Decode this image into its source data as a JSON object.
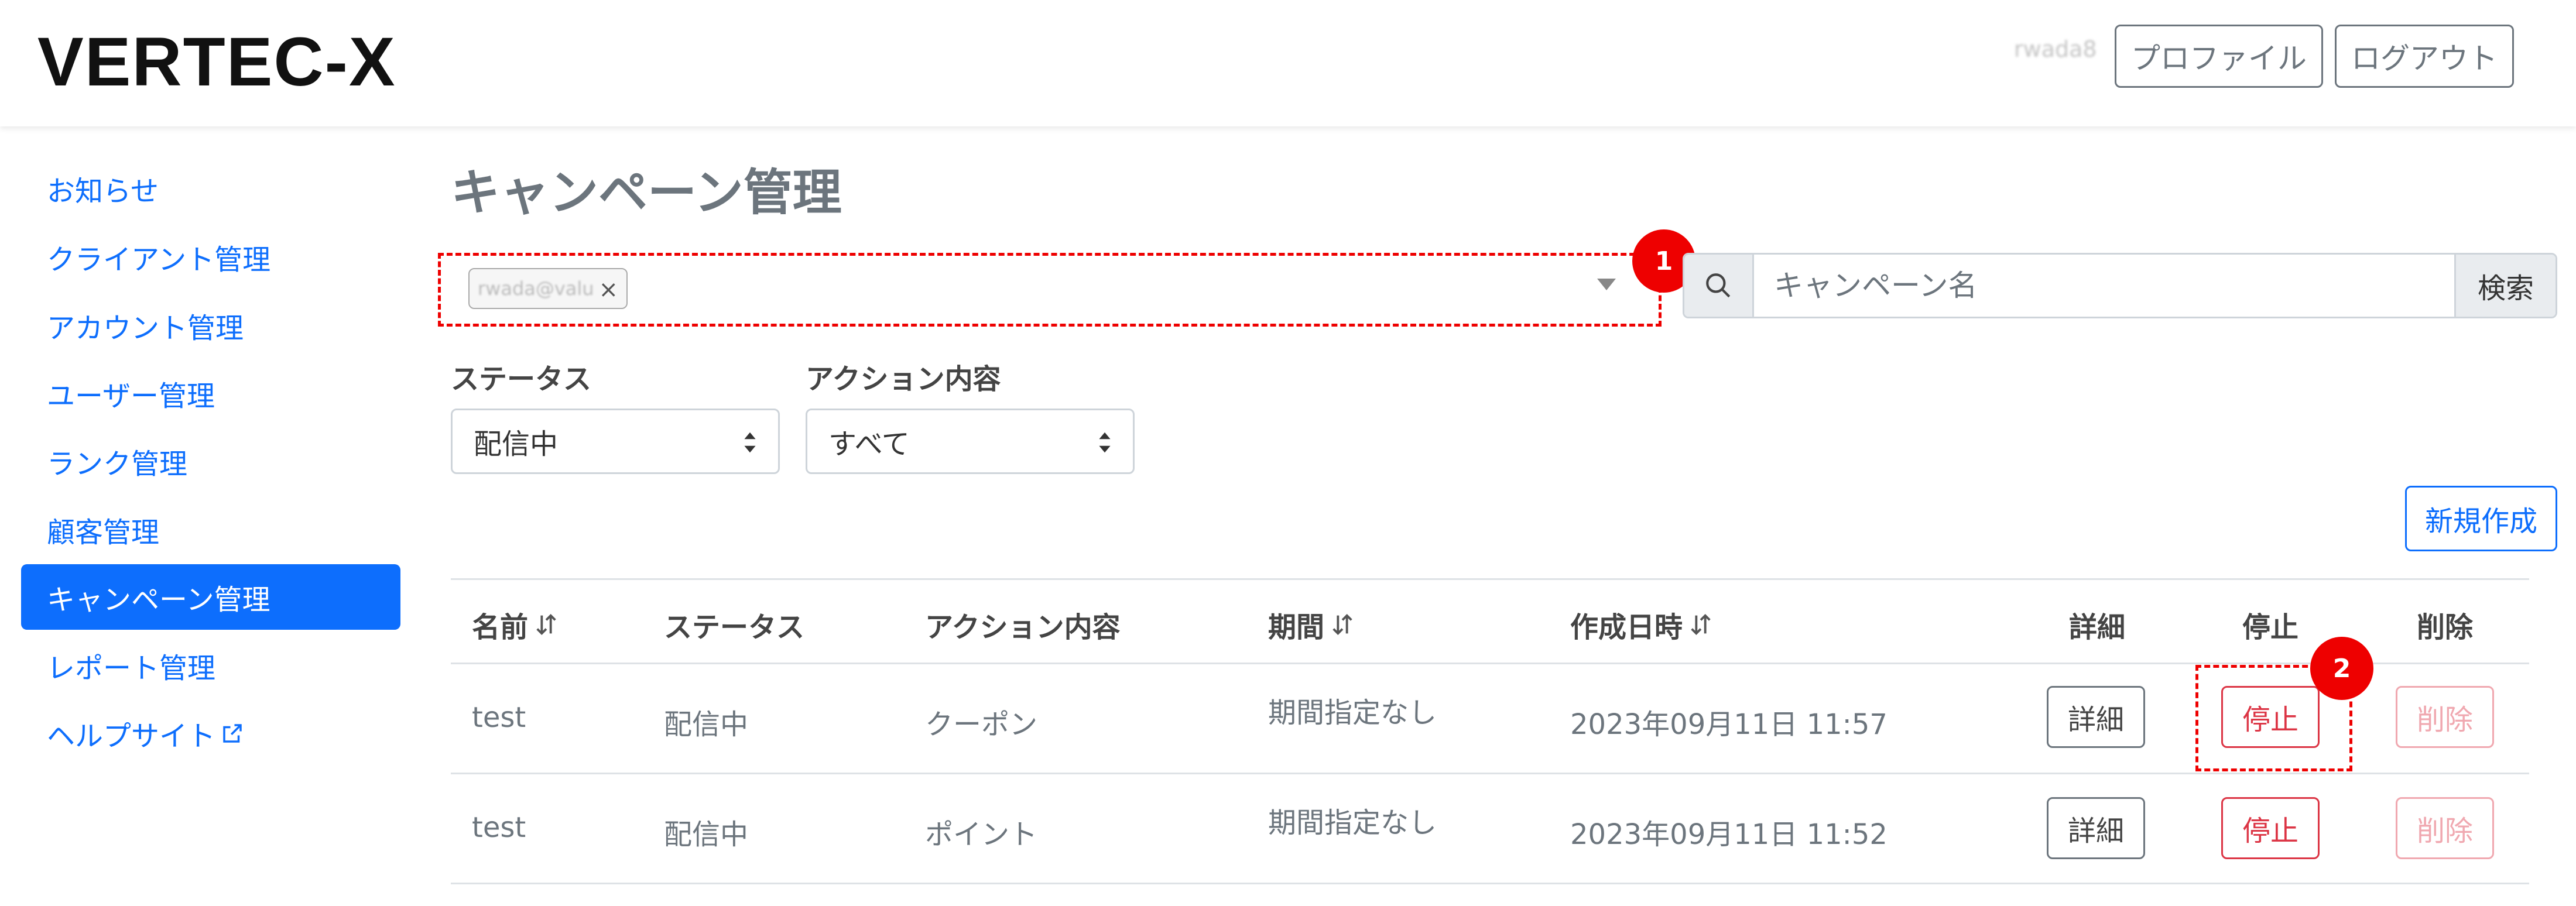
{
  "header": {
    "logo": "VERTEC-X",
    "username": "rwada8",
    "profile_label": "プロファイル",
    "logout_label": "ログアウト"
  },
  "sidebar": {
    "items": [
      {
        "label": "お知らせ",
        "active": false
      },
      {
        "label": "クライアント管理",
        "active": false
      },
      {
        "label": "アカウント管理",
        "active": false
      },
      {
        "label": "ユーザー管理",
        "active": false
      },
      {
        "label": "ランク管理",
        "active": false
      },
      {
        "label": "顧客管理",
        "active": false
      },
      {
        "label": "キャンペーン管理",
        "active": true
      },
      {
        "label": "レポート管理",
        "active": false
      },
      {
        "label": "ヘルプサイト",
        "active": false,
        "external": true
      }
    ]
  },
  "main": {
    "title": "キャンペーン管理",
    "client_filter": {
      "tag": "rwada@valu",
      "remove_symbol": "×"
    },
    "search": {
      "placeholder": "キャンペーン名",
      "button_label": "検索",
      "icon": "search-icon"
    },
    "status_filter": {
      "label": "ステータス",
      "selected": "配信中"
    },
    "action_filter": {
      "label": "アクション内容",
      "selected": "すべて"
    },
    "new_button_label": "新規作成",
    "annotations": [
      "1",
      "2"
    ],
    "table": {
      "headers": [
        "名前",
        "ステータス",
        "アクション内容",
        "期間",
        "作成日時",
        "詳細",
        "停止",
        "削除"
      ],
      "rows": [
        {
          "name": "test",
          "status": "配信中",
          "action": "クーポン",
          "period": "期間指定なし",
          "created": "2023年09月11日 11:57",
          "detail": "詳細",
          "stop": "停止",
          "delete": "削除"
        },
        {
          "name": "test",
          "status": "配信中",
          "action": "ポイント",
          "period": "期間指定なし",
          "created": "2023年09月11日 11:52",
          "detail": "詳細",
          "stop": "停止",
          "delete": "削除"
        }
      ]
    }
  },
  "colors": {
    "primary": "#0d6efd",
    "danger": "#dc3545",
    "annotation": "#ee0000",
    "muted": "#6c757d"
  }
}
